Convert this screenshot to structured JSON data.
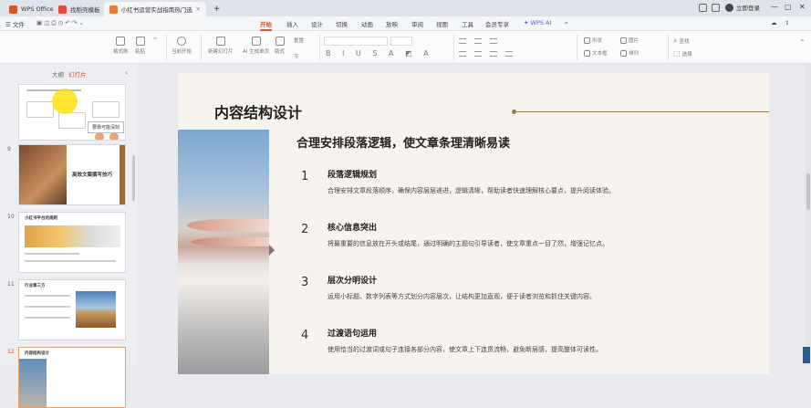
{
  "titlebar": {
    "tabs": [
      {
        "label": "WPS Office"
      },
      {
        "label": "找稻壳模板"
      },
      {
        "label": "小红书运营实战指南热门选题"
      }
    ],
    "new_tab": "+",
    "login": "立即登录"
  },
  "menu": {
    "items": [
      "文件",
      "开始",
      "插入",
      "设计",
      "切换",
      "动画",
      "放映",
      "审阅",
      "视图",
      "工具",
      "会员专享"
    ],
    "wps_ai": "WPS AI",
    "active": "开始"
  },
  "ribbon": {
    "buttons": [
      "格式刷",
      "粘贴",
      "当前开始",
      "新建幻灯片",
      "AI 生成单页",
      "版式",
      "节",
      "重置",
      "形状",
      "图片",
      "文本框",
      "排列",
      "查找",
      "选择"
    ]
  },
  "sidebar": {
    "tabs": [
      "大纲",
      "幻灯片"
    ],
    "thumb_nums": [
      "9",
      "10",
      "11",
      "12"
    ],
    "thumb_texts": {
      "s8_callout": "要靠可能深刻",
      "s9_title": "高效文案撰写技巧",
      "s10_title": "小红书平台的规则",
      "s11_title": "行业第三方",
      "s12_title": "内容结构设计"
    }
  },
  "slide": {
    "title": "内容结构设计",
    "subtitle": "合理安排段落逻辑，使文章条理清晰易读",
    "items": [
      {
        "num": "1",
        "title": "段落逻辑规划",
        "desc": "合理安排文章段落顺序，确保内容层层递进，逻辑清晰，帮助读者快速理解核心要点，提升阅读体验。"
      },
      {
        "num": "2",
        "title": "核心信息突出",
        "desc": "将最重要的信息放在开头或结尾，通过明确的主题句引导读者，使文章重点一目了然，增强记忆点。"
      },
      {
        "num": "3",
        "title": "层次分明设计",
        "desc": "运用小标题、数字列表等方式划分内容层次，让结构更加直观，便于读者浏览和抓住关键内容。"
      },
      {
        "num": "4",
        "title": "过渡语句运用",
        "desc": "使用恰当的过渡词或句子连接各部分内容，使文章上下连贯流畅，避免断层感，提高整体可读性。"
      }
    ]
  },
  "colors": {
    "accent": "#d9532c",
    "slide_bg": "#f7f3ef"
  }
}
